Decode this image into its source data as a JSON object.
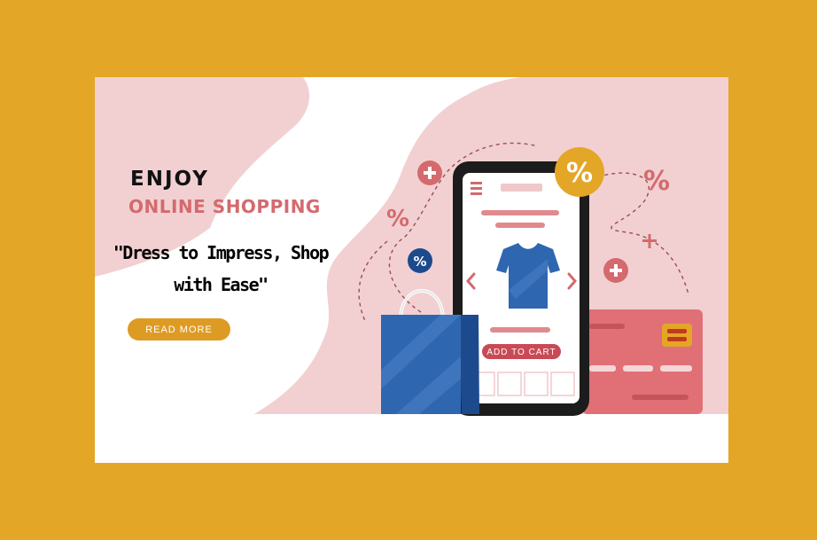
{
  "banner": {
    "headline": "ENJOY",
    "subheadline": "ONLINE SHOPPING",
    "tagline_line1": "\"Dress to Impress, Shop",
    "tagline_line2": "with Ease\"",
    "cta_label": "READ MORE"
  },
  "phone": {
    "add_to_cart_label": "ADD TO CART",
    "badge_text": "%"
  },
  "decorations": {
    "percent_symbol": "%",
    "plus_symbol": "+"
  },
  "colors": {
    "frame": "#E4A626",
    "pink_bg": "#F2D0D2",
    "accent_red": "#D46A6E",
    "gold": "#DE9B24",
    "bag_blue": "#2F66B0",
    "shirt_blue": "#2F66B0"
  },
  "icons": [
    "menu-icon",
    "shirt-icon",
    "chevron-left-icon",
    "chevron-right-icon",
    "shopping-bag-icon",
    "credit-card-icon",
    "plus-icon",
    "percent-icon"
  ]
}
